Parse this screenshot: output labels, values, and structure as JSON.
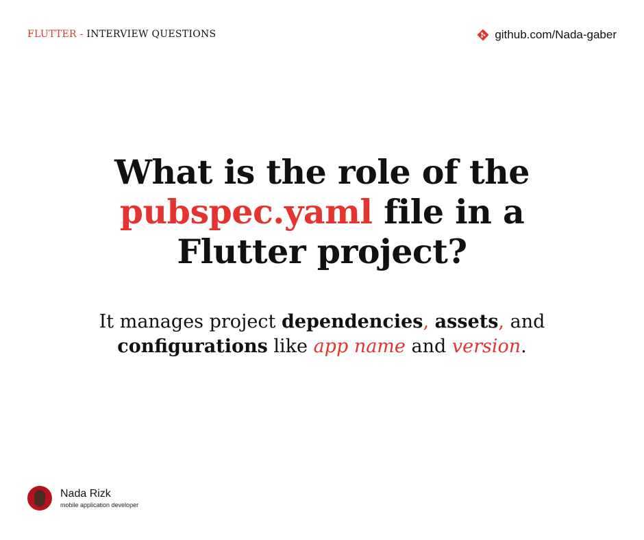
{
  "header": {
    "topic": "FLUTTER",
    "separator": " - ",
    "series": "INTERVIEW QUESTIONS",
    "github_icon": "git-icon",
    "github_link": "github.com/Nada-gaber"
  },
  "question": {
    "line1": "What is the role of the",
    "highlight": "pubspec.yaml",
    "line2_rest": " file in a",
    "line3": "Flutter project?"
  },
  "answer": {
    "p1": "It manages project ",
    "b1": "dependencies",
    "c1": ",",
    "sp1": " ",
    "b2": "assets",
    "c2": ",",
    "p2": " and",
    "b3": "configurations",
    "p3": " like ",
    "i1": "app name",
    "p4": " and ",
    "i2": "version",
    "dot": "."
  },
  "author": {
    "name": "Nada Rizk",
    "role": "mobile application developer"
  },
  "colors": {
    "accent": "#e3342f",
    "text": "#111111",
    "background": "#ffffff"
  }
}
